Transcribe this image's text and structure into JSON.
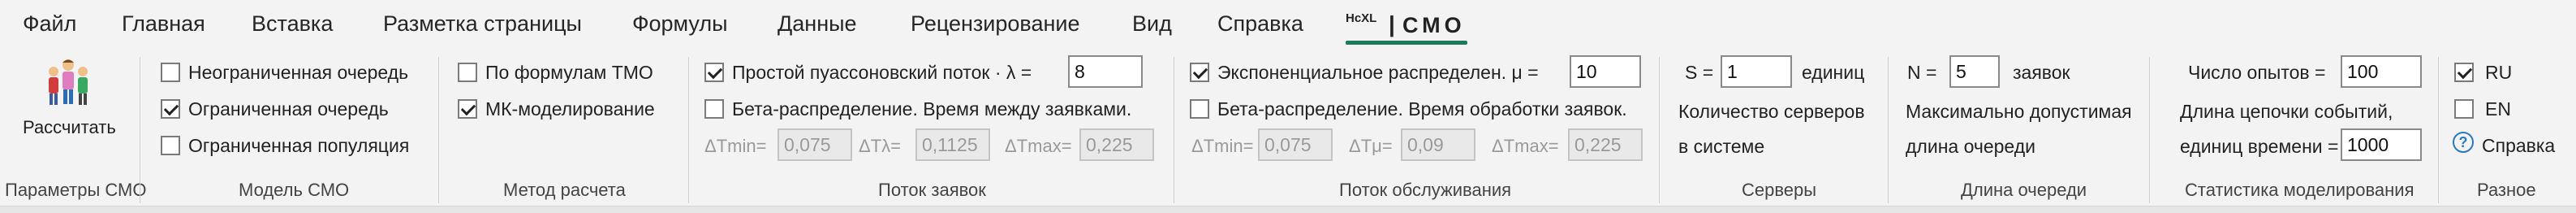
{
  "tabs": [
    "Файл",
    "Главная",
    "Вставка",
    "Разметка страницы",
    "Формулы",
    "Данные",
    "Рецензирование",
    "Вид",
    "Справка"
  ],
  "active_tab": {
    "logo": "HcXL",
    "title": "СМО"
  },
  "groups": {
    "params": {
      "label": "Параметры СМО",
      "button": "Рассчитать"
    },
    "model": {
      "label": "Модель СМО",
      "options": [
        {
          "text": "Неограниченная очередь",
          "checked": false
        },
        {
          "text": "Ограниченная очередь",
          "checked": true
        },
        {
          "text": "Ограниченная популяция",
          "checked": false
        }
      ]
    },
    "method": {
      "label": "Метод расчета",
      "options": [
        {
          "text": "По формулам ТМО",
          "checked": false
        },
        {
          "text": "МК-моделирование",
          "checked": true
        }
      ]
    },
    "flow": {
      "label": "Поток заявок",
      "poisson": {
        "text": "Простой пуассоновский поток  ·  λ =",
        "checked": true,
        "value": "8"
      },
      "beta": {
        "text": "Бета-распределение. Время между заявками.",
        "checked": false
      },
      "tmin": {
        "label": "ΔTmin=",
        "value": "0,075"
      },
      "tl": {
        "label": "ΔTλ=",
        "value": "0,1125"
      },
      "tmax": {
        "label": "ΔTmax=",
        "value": "0,225"
      }
    },
    "service": {
      "label": "Поток обслуживания",
      "exp": {
        "text": "Экспоненциальное распределен.  μ =",
        "checked": true,
        "value": "10"
      },
      "beta": {
        "text": "Бета-распределение. Время обработки заявок.",
        "checked": false
      },
      "tmin": {
        "label": "ΔTmin=",
        "value": "0,075"
      },
      "tmu": {
        "label": "ΔTμ=",
        "value": "0,09"
      },
      "tmax": {
        "label": "ΔTmax=",
        "value": "0,225"
      }
    },
    "servers": {
      "label": "Серверы",
      "prefix": "S =",
      "value": "1",
      "unit": "единиц",
      "line2": "Количество серверов",
      "line3": "в системе"
    },
    "queue": {
      "label": "Длина очереди",
      "prefix": "N =",
      "value": "5",
      "unit": "заявок",
      "line2": "Максимально допустимая",
      "line3": "длина очереди"
    },
    "stats": {
      "label": "Статистика моделирования",
      "trials_label": "Число опытов =",
      "trials_value": "100",
      "line2": "Длина цепочки событий,",
      "unit_label": "единиц времени =",
      "unit_value": "1000"
    },
    "misc": {
      "label": "Разное",
      "ru": {
        "text": "RU",
        "checked": true
      },
      "en": {
        "text": "EN",
        "checked": false
      },
      "help": "Справка"
    }
  }
}
